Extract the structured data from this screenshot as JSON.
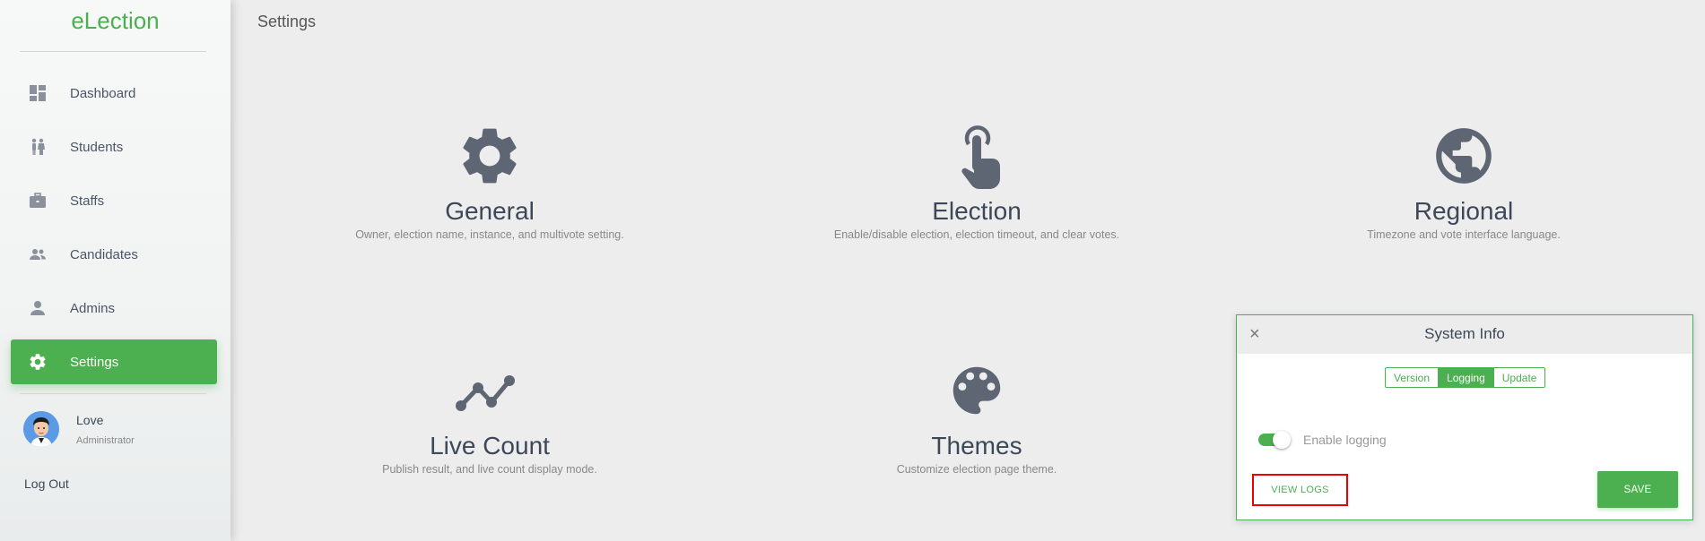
{
  "app": {
    "logo": "eLection"
  },
  "sidebar": {
    "items": [
      {
        "label": "Dashboard",
        "icon": "dashboard-icon"
      },
      {
        "label": "Students",
        "icon": "students-icon"
      },
      {
        "label": "Staffs",
        "icon": "briefcase-icon"
      },
      {
        "label": "Candidates",
        "icon": "candidates-icon"
      },
      {
        "label": "Admins",
        "icon": "person-icon"
      },
      {
        "label": "Settings",
        "icon": "gear-icon",
        "active": true
      }
    ],
    "user": {
      "name": "Love",
      "role": "Administrator"
    },
    "logout_label": "Log Out"
  },
  "main": {
    "title": "Settings",
    "cards": [
      {
        "title": "General",
        "desc": "Owner, election name, instance, and multivote setting.",
        "icon": "gear-icon"
      },
      {
        "title": "Election",
        "desc": "Enable/disable election, election timeout, and clear votes.",
        "icon": "touch-icon"
      },
      {
        "title": "Regional",
        "desc": "Timezone and vote interface language.",
        "icon": "globe-icon"
      },
      {
        "title": "Live Count",
        "desc": "Publish result, and live count display mode.",
        "icon": "line-chart-icon"
      },
      {
        "title": "Themes",
        "desc": "Customize election page theme.",
        "icon": "palette-icon"
      }
    ]
  },
  "modal": {
    "title": "System Info",
    "close": "×",
    "tabs": [
      "Version",
      "Logging",
      "Update"
    ],
    "active_tab": "Logging",
    "toggle_label": "Enable logging",
    "toggle_on": true,
    "view_logs": "VIEW LOGS",
    "save": "SAVE"
  },
  "colors": {
    "accent": "#4caf50",
    "icon": "#5e6573",
    "highlight": "#e00000"
  }
}
